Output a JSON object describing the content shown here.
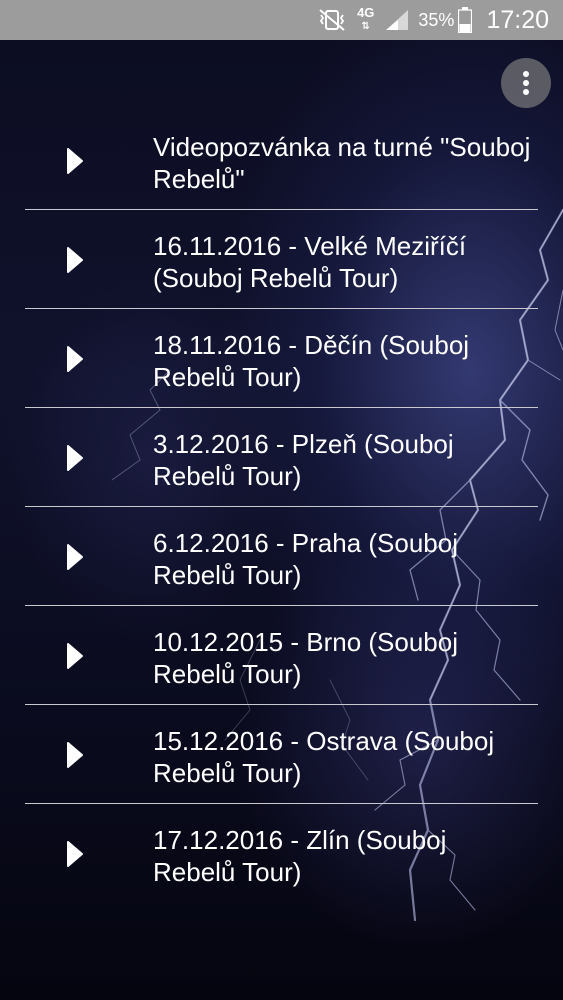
{
  "status_bar": {
    "network_type": "4G",
    "battery_percent": "35%",
    "time": "17:20",
    "icons": [
      "vibrate-icon",
      "network-4g-icon",
      "signal-icon",
      "battery-icon"
    ]
  },
  "menu": {
    "icon": "overflow-menu-icon"
  },
  "episodes": [
    {
      "title": "Videopozvánka na turné \"Souboj Rebelů\"",
      "icon": "play-icon"
    },
    {
      "title": "16.11.2016 - Velké Meziříčí (Souboj Rebelů Tour)",
      "icon": "play-icon"
    },
    {
      "title": "18.11.2016 - Děčín (Souboj Rebelů Tour)",
      "icon": "play-icon"
    },
    {
      "title": "3.12.2016 - Plzeň (Souboj Rebelů Tour)",
      "icon": "play-icon"
    },
    {
      "title": "6.12.2016 - Praha (Souboj Rebelů Tour)",
      "icon": "play-icon"
    },
    {
      "title": "10.12.2015 - Brno (Souboj Rebelů Tour)",
      "icon": "play-icon"
    },
    {
      "title": "15.12.2016 - Ostrava (Souboj Rebelů Tour)",
      "icon": "play-icon"
    },
    {
      "title": "17.12.2016 - Zlín (Souboj Rebelů Tour)",
      "icon": "play-icon"
    }
  ],
  "colors": {
    "status_bar": "#9c9c9c",
    "text": "#ffffff",
    "divider": "#c9c9cf",
    "background": "#0c0d22"
  }
}
